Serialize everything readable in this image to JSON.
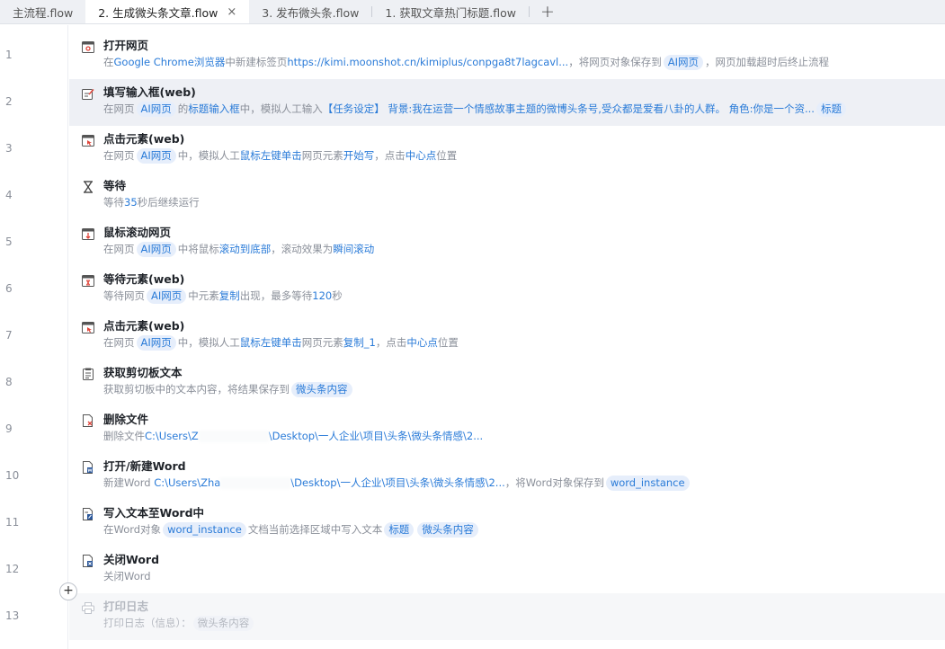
{
  "tabs": [
    {
      "label": "主流程.flow",
      "active": false
    },
    {
      "label": "2. 生成微头条文章.flow",
      "active": true,
      "close": "×"
    },
    {
      "label": "3. 发布微头条.flow",
      "active": false
    },
    {
      "label": "1. 获取文章热门标题.flow",
      "active": false
    }
  ],
  "tab_add": "+",
  "add_step": "+",
  "lines": [
    "1",
    "2",
    "3",
    "4",
    "5",
    "6",
    "7",
    "8",
    "9",
    "10",
    "11",
    "12",
    "13"
  ],
  "rows": [
    {
      "title": "打开网页",
      "d": [
        "在",
        "Google Chrome浏览器",
        "中新建标签页",
        "https://kimi.moonshot.cn/kimiplus/conpga8t7lagcavl...",
        "，将网页对象保存到",
        "AI网页",
        "，网页加载超时后终止流程"
      ]
    },
    {
      "title": "填写输入框(web)",
      "d": [
        "在网页",
        "AI网页",
        "的",
        "标题输入框",
        "中，模拟人工输入",
        "【任务设定】 背景:我在运营一个情感故事主题的微博头条号,受众都是爱看八卦的人群。 角色:你是一个资...",
        "标题"
      ]
    },
    {
      "title": "点击元素(web)",
      "d": [
        "在网页",
        "AI网页",
        "中，模拟人工",
        "鼠标左键单击",
        "网页元素",
        "开始写",
        "，点击",
        "中心点",
        "位置"
      ]
    },
    {
      "title": "等待",
      "d": [
        "等待",
        "35",
        "秒后继续运行"
      ]
    },
    {
      "title": "鼠标滚动网页",
      "d": [
        "在网页",
        "AI网页",
        "中将鼠标",
        "滚动到底部",
        "，滚动效果为",
        "瞬间滚动"
      ]
    },
    {
      "title": "等待元素(web)",
      "d": [
        "等待网页",
        "AI网页",
        "中元素",
        "复制",
        "出现，最多等待",
        "120",
        "秒"
      ]
    },
    {
      "title": "点击元素(web)",
      "d": [
        "在网页",
        "AI网页",
        "中，模拟人工",
        "鼠标左键单击",
        "网页元素",
        "复制_1",
        "，点击",
        "中心点",
        "位置"
      ]
    },
    {
      "title": "获取剪切板文本",
      "d": [
        "获取剪切板中的文本内容，将结果保存到",
        "微头条内容"
      ]
    },
    {
      "title": "删除文件",
      "d": [
        "删除文件",
        "C:\\Users\\Z",
        "\\Desktop\\一人企业\\项目\\头条\\微头条情感\\2..."
      ]
    },
    {
      "title": "打开/新建Word",
      "d": [
        "新建Word ",
        "C:\\Users\\Zha",
        "\\Desktop\\一人企业\\项目\\头条\\微头条情感\\2...",
        "，将Word对象保存到",
        "word_instance"
      ]
    },
    {
      "title": "写入文本至Word中",
      "d": [
        "在Word对象",
        "word_instance",
        "文档当前选择区域中写入文本",
        "标题",
        "微头条内容"
      ]
    },
    {
      "title": "关闭Word",
      "d": [
        "关闭Word"
      ]
    },
    {
      "title": "打印日志",
      "d": [
        "打印日志（信息）：",
        "微头条内容"
      ]
    }
  ]
}
